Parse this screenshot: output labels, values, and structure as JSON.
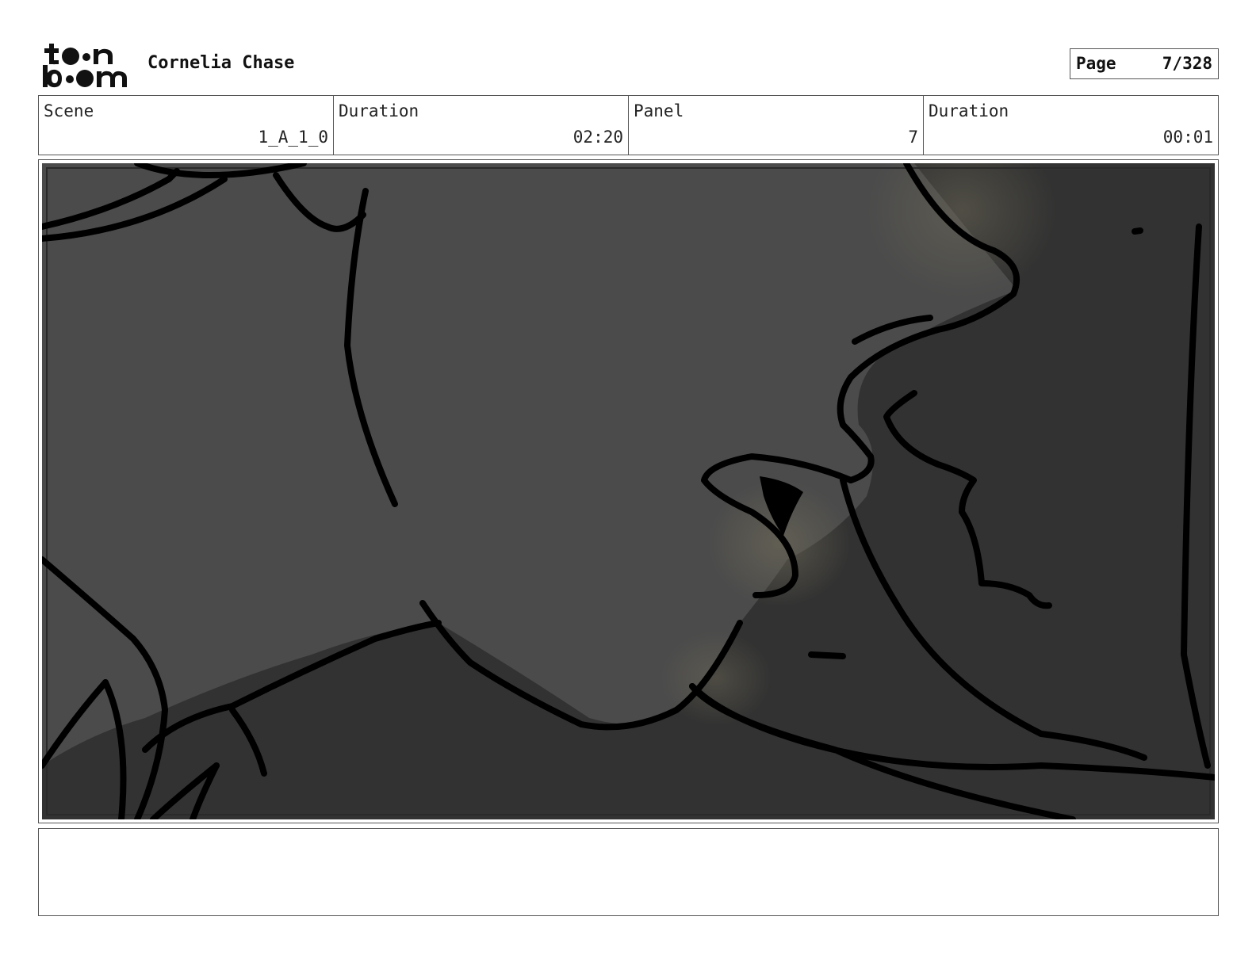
{
  "header": {
    "logo": {
      "icon": "toon-boom-logo",
      "lines": [
        "toon",
        "boom"
      ]
    },
    "project_title": "Cornelia Chase",
    "page": {
      "label": "Page",
      "value": "7/328"
    }
  },
  "info": {
    "scene": {
      "label": "Scene",
      "value": "1_A_1_0"
    },
    "scene_duration": {
      "label": "Duration",
      "value": "02:20"
    },
    "panel": {
      "label": "Panel",
      "value": "7"
    },
    "panel_duration": {
      "label": "Duration",
      "value": "00:01"
    }
  },
  "panel_image": {
    "icon": "storyboard-sketch-image",
    "colors": {
      "light": "#4b4b4b",
      "dark": "#323232",
      "highlight": "#6e6a58",
      "ink": "#000000"
    }
  },
  "notes": {
    "text": ""
  }
}
